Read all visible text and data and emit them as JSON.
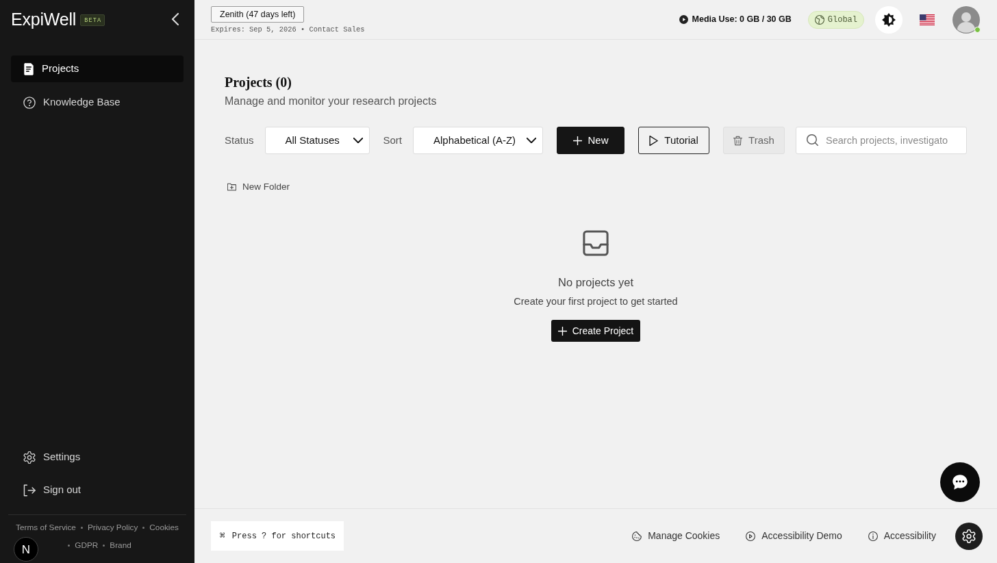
{
  "sidebar": {
    "logo": "ExpiWell",
    "logo_badge": "BETA",
    "nav": [
      {
        "label": "Projects",
        "selected": true
      },
      {
        "label": "Knowledge Base",
        "selected": false
      }
    ],
    "account_nav": [
      {
        "label": "Settings"
      },
      {
        "label": "Sign out"
      }
    ],
    "footer_links": [
      "Terms of Service",
      "Privacy Policy",
      "Cookies",
      "GDPR",
      "Brand"
    ],
    "dev_badge": "N"
  },
  "topbar": {
    "plan_button": "Zenith (47 days left)",
    "expiry_text": "Expires: Sep 5, 2026 •",
    "contact_link": "Contact Sales",
    "media_use": "Media Use: 0 GB / 30 GB",
    "region": "Global",
    "avatar": {
      "online": true
    }
  },
  "page": {
    "title": "Projects (0)",
    "subtitle": "Manage and monitor your research projects"
  },
  "toolbar": {
    "filters": [
      {
        "label": "Status",
        "value": "All Statuses"
      },
      {
        "label": "Sort",
        "value": "Alphabetical (A-Z)"
      }
    ],
    "buttons": [
      {
        "label": "New",
        "kind": "primary"
      },
      {
        "label": "Tutorial",
        "kind": "outline"
      },
      {
        "label": "Trash",
        "kind": "muted"
      }
    ],
    "search": {
      "placeholder": "Search projects, investigato"
    }
  },
  "new_folder": "New Folder",
  "empty_state": {
    "title": "No projects yet",
    "message": "Create your first project to get started",
    "button": "Create Project"
  },
  "bottom_bar": {
    "shortcut_key": "⌘",
    "shortcut_hint": "Press ? for shortcuts",
    "links": [
      {
        "label": "Manage Cookies"
      },
      {
        "label": "Accessibility Demo"
      },
      {
        "label": "Accessibility"
      }
    ]
  }
}
